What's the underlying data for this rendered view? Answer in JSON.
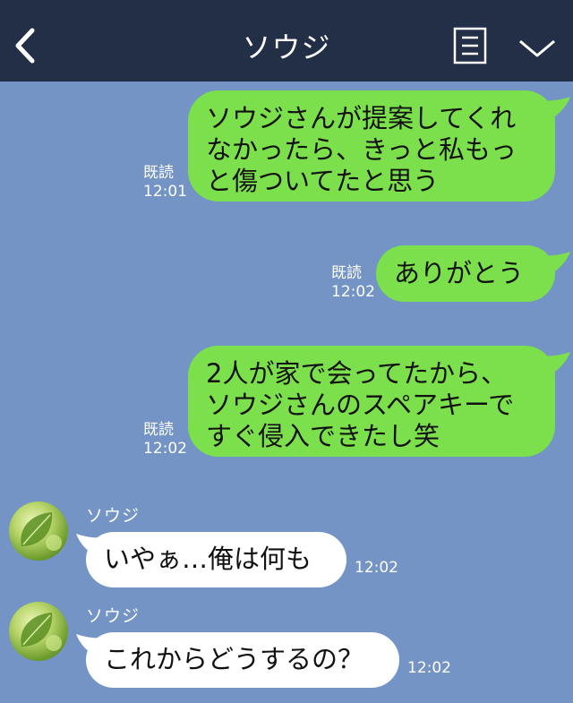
{
  "header": {
    "title": "ソウジ",
    "icons": {
      "back": "chevron-left-icon",
      "menu": "list-icon",
      "expand": "chevron-down-icon"
    }
  },
  "colors": {
    "background": "#7394c4",
    "header": "#232e47",
    "outgoing_bubble": "#7be04b",
    "incoming_bubble": "#ffffff"
  },
  "messages": [
    {
      "direction": "out",
      "lines": [
        "ソウジさんが提案してくれ",
        "なかったら、きっと私もっ",
        "と傷ついてたと思う"
      ],
      "read_label": "既読",
      "time": "12:01"
    },
    {
      "direction": "out",
      "lines": [
        "ありがとう"
      ],
      "read_label": "既読",
      "time": "12:02"
    },
    {
      "direction": "out",
      "lines": [
        "2人が家で会ってたから、",
        "ソウジさんのスペアキーで",
        "すぐ侵入できたし笑"
      ],
      "read_label": "既読",
      "time": "12:02"
    },
    {
      "direction": "in",
      "sender": "ソウジ",
      "text": "いやぁ…俺は何も",
      "time": "12:02",
      "avatar": "leaf-avatar"
    },
    {
      "direction": "in",
      "sender": "ソウジ",
      "text": "これからどうするの？",
      "time": "12:02",
      "avatar": "leaf-avatar"
    }
  ]
}
